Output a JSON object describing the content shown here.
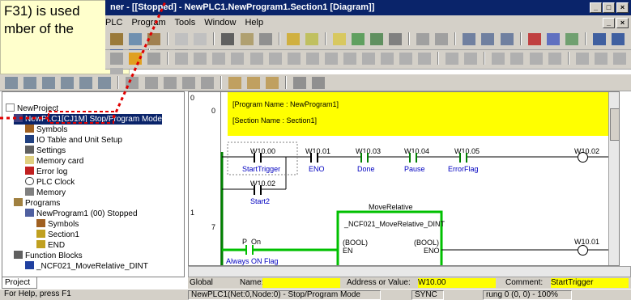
{
  "window": {
    "title": "ner - [[Stopped] - NewPLC1.NewProgram1.Section1 [Diagram]]",
    "controls": [
      "_",
      "□",
      "×"
    ]
  },
  "callout": {
    "line1": "F31) is used",
    "line2": "mber of the"
  },
  "menu": [
    "PLC",
    "Program",
    "Tools",
    "Window",
    "Help"
  ],
  "tree": {
    "items": [
      {
        "label": "NewProject",
        "icon": "project-icon"
      },
      {
        "label": "NewPLC1[CJ1M] Stop/Program Mode",
        "icon": "plc-icon"
      },
      {
        "label": "Symbols",
        "icon": "symbols-icon"
      },
      {
        "label": "IO Table and Unit Setup",
        "icon": "io-table-icon"
      },
      {
        "label": "Settings",
        "icon": "settings-icon"
      },
      {
        "label": "Memory card",
        "icon": "memory-card-icon"
      },
      {
        "label": "Error log",
        "icon": "error-log-icon"
      },
      {
        "label": "PLC Clock",
        "icon": "clock-icon"
      },
      {
        "label": "Memory",
        "icon": "memory-icon"
      },
      {
        "label": "Programs",
        "icon": "programs-icon"
      },
      {
        "label": "NewProgram1 (00) Stopped",
        "icon": "program-icon"
      },
      {
        "label": "Symbols",
        "icon": "symbols-icon"
      },
      {
        "label": "Section1",
        "icon": "section-icon"
      },
      {
        "label": "END",
        "icon": "end-icon"
      },
      {
        "label": "Function Blocks",
        "icon": "function-blocks-icon"
      },
      {
        "label": "_NCF021_MoveRelative_DINT",
        "icon": "function-block-icon"
      }
    ],
    "tab": "Project"
  },
  "ladder": {
    "rung0_number": "0",
    "rung1_number": "1",
    "line0": "0",
    "line7": "7",
    "program_name": "[Program Name : NewProgram1]",
    "section_name": "[Section Name : Section1]",
    "contacts": [
      {
        "addr": "W10.00",
        "name": "StartTrigger"
      },
      {
        "addr": "W10.01",
        "name": "ENO"
      },
      {
        "addr": "W10.03",
        "name": "Done"
      },
      {
        "addr": "W10.04",
        "name": "Pause"
      },
      {
        "addr": "W10.05",
        "name": "ErrorFlag"
      }
    ],
    "coil": {
      "addr": "W10.02"
    },
    "branch": {
      "addr": "W10.02",
      "name": "Start2"
    },
    "fb": {
      "label": "MoveRelative",
      "name": "_NCF021_MoveRelative_DINT",
      "en_type": "(BOOL)",
      "en": "EN",
      "eno_type": "(BOOL)",
      "eno": "ENO"
    },
    "p_on": "P_On",
    "p_on_comment": "Always ON Flag",
    "coil2": {
      "addr": "W10.01"
    }
  },
  "addressbar": {
    "scope": "Global",
    "name_label": "Name:",
    "name_value": "",
    "addr_label": "Address or Value:",
    "addr_value": "W10.00",
    "comment_label": "Comment:",
    "comment_value": "StartTrigger"
  },
  "status": {
    "help": "For Help, press F1",
    "plc": "NewPLC1(Net:0,Node:0) - Stop/Program Mode",
    "sync": "SYNC",
    "rung": "rung 0 (0, 0)  - 100%"
  }
}
